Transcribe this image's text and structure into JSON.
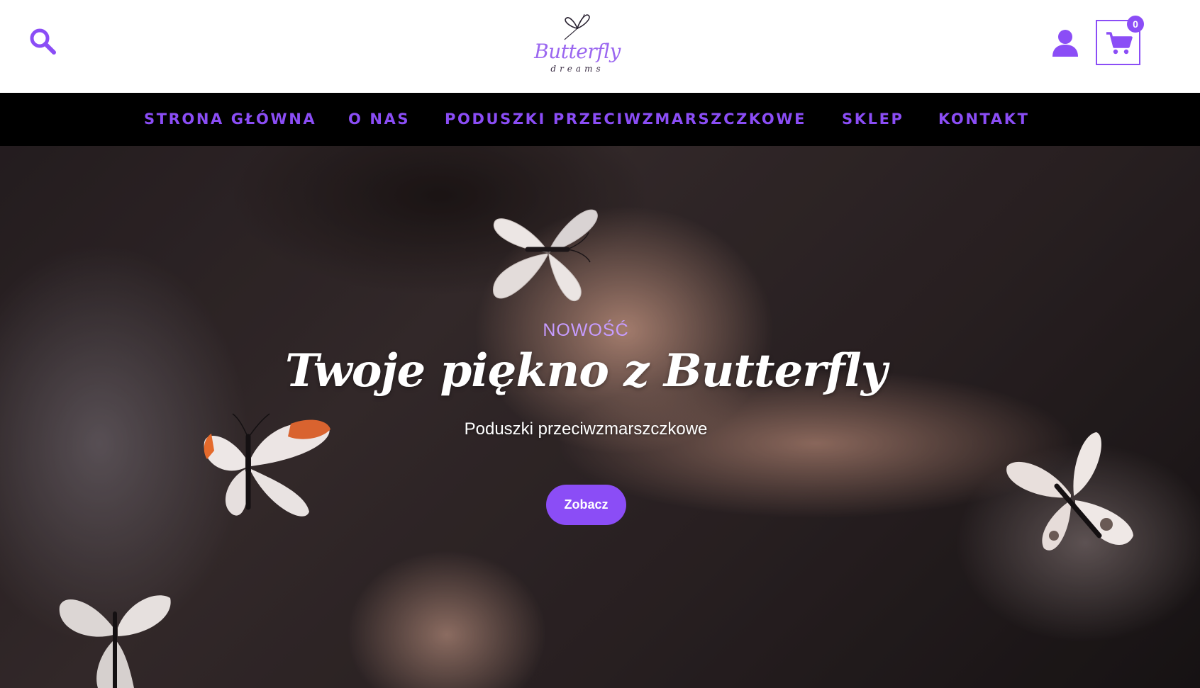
{
  "header": {
    "logo": {
      "name": "Butterfly",
      "tagline": "dreams"
    },
    "cart_count": "0",
    "brand_color": "#8b4df6",
    "icons": [
      "search-icon",
      "user-icon",
      "cart-icon"
    ]
  },
  "nav": {
    "items": [
      {
        "label": "STRONA GŁÓWNA"
      },
      {
        "label": "O NAS"
      },
      {
        "label": "PODUSZKI PRZECIWZMARSZCZKOWE"
      },
      {
        "label": "SKLEP"
      },
      {
        "label": "KONTAKT"
      }
    ]
  },
  "hero": {
    "kicker": "NOWOŚĆ",
    "title": "Twoje piękno z Butterfly",
    "subtitle": "Poduszki przeciwzmarszczkowe",
    "button_label": "Zobacz"
  }
}
